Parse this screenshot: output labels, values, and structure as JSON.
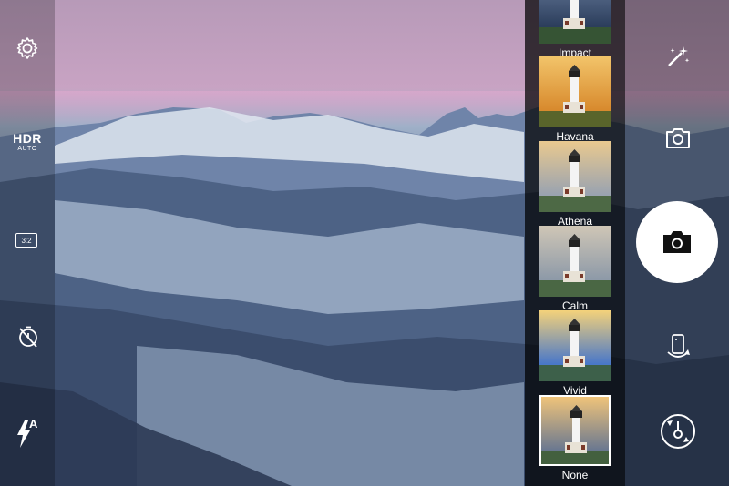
{
  "left_toolbar": {
    "hdr_label": "HDR",
    "hdr_mode": "AUTO",
    "aspect_ratio": "3:2",
    "flash_mode": "A"
  },
  "filters": [
    {
      "name": "Impact",
      "selected": false
    },
    {
      "name": "Havana",
      "selected": false
    },
    {
      "name": "Athena",
      "selected": false
    },
    {
      "name": "Calm",
      "selected": false
    },
    {
      "name": "Vivid",
      "selected": false
    },
    {
      "name": "None",
      "selected": true
    }
  ],
  "right_toolbar": {
    "icons": [
      "magic-wand-icon",
      "camera-icon",
      "shutter-camera-icon",
      "rotate-device-icon",
      "switch-camera-icon"
    ]
  }
}
